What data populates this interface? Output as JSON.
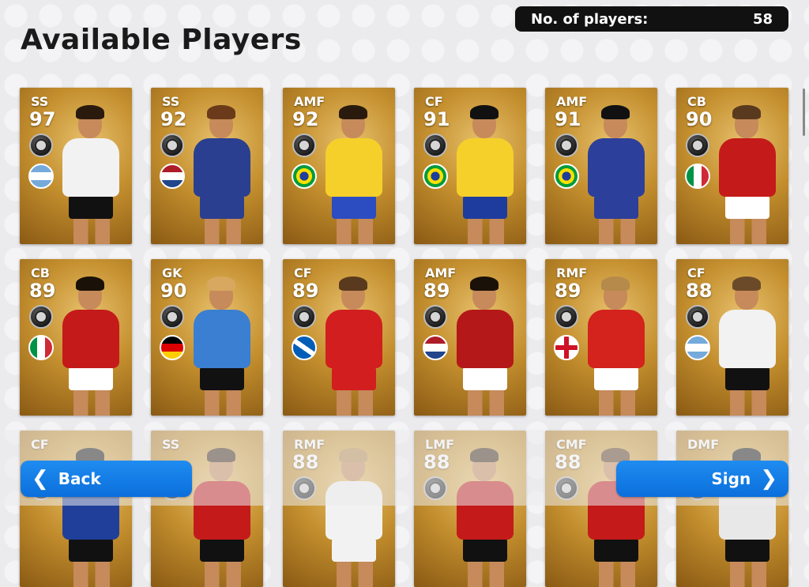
{
  "header": {
    "title": "Available Players",
    "count_label": "No. of players:",
    "count_value": "58"
  },
  "players": [
    {
      "pos": "SS",
      "rating": "97",
      "flag": "argentina",
      "kit": "#f2f2f2",
      "shorts": "#111111",
      "hair": "#2a1a0e"
    },
    {
      "pos": "SS",
      "rating": "92",
      "flag": "netherlands",
      "kit": "#2a3f8f",
      "shorts": "#2a3f8f",
      "hair": "#6b3a1a"
    },
    {
      "pos": "AMF",
      "rating": "92",
      "flag": "brazil",
      "kit": "#f5d02a",
      "shorts": "#2c4dc2",
      "hair": "#2a1a0e"
    },
    {
      "pos": "CF",
      "rating": "91",
      "flag": "brazil",
      "kit": "#f5d02a",
      "shorts": "#1d3c9e",
      "hair": "#111111"
    },
    {
      "pos": "AMF",
      "rating": "91",
      "flag": "brazil",
      "kit": "#2c3f9a",
      "shorts": "#2c3f9a",
      "hair": "#111111"
    },
    {
      "pos": "CB",
      "rating": "90",
      "flag": "italy",
      "kit": "#c41a1a",
      "shorts": "#ffffff",
      "hair": "#5a3a1e"
    },
    {
      "pos": "CB",
      "rating": "89",
      "flag": "italy",
      "kit": "#c41a1a",
      "shorts": "#ffffff",
      "hair": "#1a1108"
    },
    {
      "pos": "GK",
      "rating": "90",
      "flag": "germany",
      "kit": "#3a7fd1",
      "shorts": "#111111",
      "hair": "#d8a860"
    },
    {
      "pos": "CF",
      "rating": "89",
      "flag": "scotland",
      "kit": "#d21e1e",
      "shorts": "#d21e1e",
      "hair": "#5a3a1e"
    },
    {
      "pos": "AMF",
      "rating": "89",
      "flag": "netherlands",
      "kit": "#b51818",
      "shorts": "#ffffff",
      "hair": "#1a1108"
    },
    {
      "pos": "RMF",
      "rating": "89",
      "flag": "england",
      "kit": "#d3231c",
      "shorts": "#ffffff",
      "hair": "#b58a4a"
    },
    {
      "pos": "CF",
      "rating": "88",
      "flag": "argentina",
      "kit": "#f2f2f2",
      "shorts": "#111111",
      "hair": "#6b4a2a"
    },
    {
      "pos": "CF",
      "rating": "",
      "flag": "",
      "kit": "#1f3f9a",
      "shorts": "#111111",
      "hair": "#111111"
    },
    {
      "pos": "SS",
      "rating": "",
      "flag": "",
      "kit": "#c41a1a",
      "shorts": "#111111",
      "hair": "#3a2614"
    },
    {
      "pos": "RMF",
      "rating": "88",
      "flag": "",
      "kit": "#f2f2f2",
      "shorts": "#f2f2f2",
      "hair": "#b58a4a"
    },
    {
      "pos": "LMF",
      "rating": "88",
      "flag": "",
      "kit": "#c41a1a",
      "shorts": "#111111",
      "hair": "#3a2614"
    },
    {
      "pos": "CMF",
      "rating": "88",
      "flag": "",
      "kit": "#c41a1a",
      "shorts": "#111111",
      "hair": "#5a3a1e"
    },
    {
      "pos": "DMF",
      "rating": "",
      "flag": "",
      "kit": "#e8e8e8",
      "shorts": "#111111",
      "hair": "#111111"
    }
  ],
  "buttons": {
    "back_label": "Back",
    "sign_label": "Sign"
  }
}
